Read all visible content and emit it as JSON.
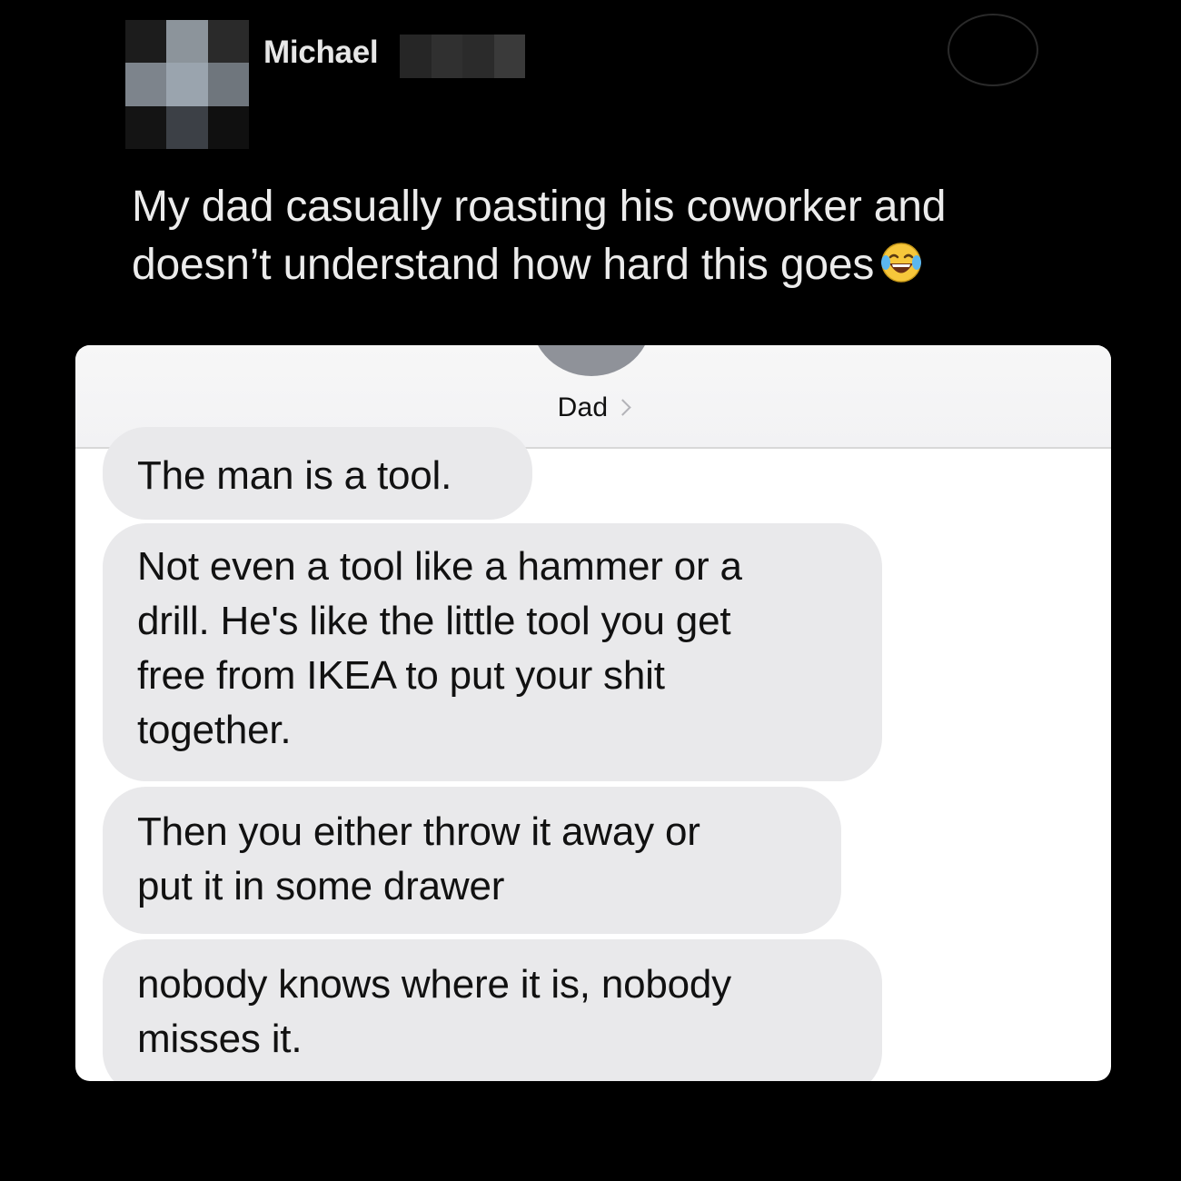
{
  "tweet": {
    "username": "Michael",
    "text_lines": [
      "My dad casually roasting his coworker and",
      "doesn’t understand how hard this goes"
    ],
    "emoji": "face-with-tears-of-joy"
  },
  "conversation": {
    "contact_name": "Dad",
    "messages": [
      {
        "lines": [
          "The man is a tool."
        ]
      },
      {
        "lines": [
          "Not even a tool like a hammer or a",
          "drill. He's like the little tool you get",
          "free from IKEA to put your shit",
          "together."
        ]
      },
      {
        "lines": [
          "Then you either throw it away or",
          "put it in some drawer"
        ]
      },
      {
        "lines": [
          "nobody knows where it is, nobody",
          "misses it."
        ]
      }
    ]
  },
  "colors": {
    "background": "#000000",
    "bubble_incoming": "#e9e9eb",
    "tweet_text": "#ececec"
  }
}
